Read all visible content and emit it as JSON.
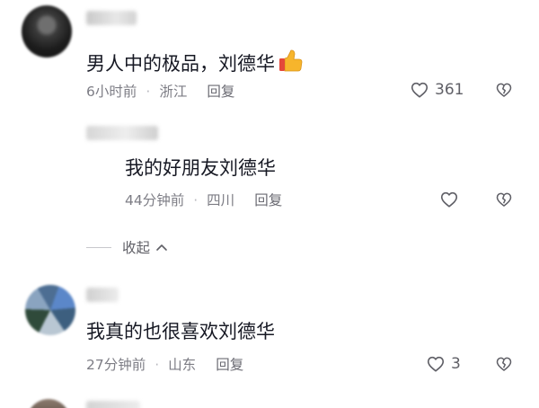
{
  "comments": [
    {
      "text": "男人中的极品，刘德华",
      "time": "6小时前",
      "location": "浙江",
      "reply_label": "回复",
      "likes": "361"
    },
    {
      "text": "我的好朋友刘德华",
      "time": "44分钟前",
      "location": "四川",
      "reply_label": "回复",
      "likes": ""
    },
    {
      "text": "我真的也很喜欢刘德华",
      "time": "27分钟前",
      "location": "山东",
      "reply_label": "回复",
      "likes": "3"
    }
  ],
  "collapse_label": "收起",
  "separator": "·",
  "icons": {
    "like": "heart-outline-icon",
    "dislike": "broken-heart-icon",
    "emoji": "thumbs-up-emoji-icon",
    "collapse": "chevron-up-icon"
  },
  "colors": {
    "text": "#161823",
    "meta": "#7d7d85",
    "icon": "#5f5f66"
  }
}
